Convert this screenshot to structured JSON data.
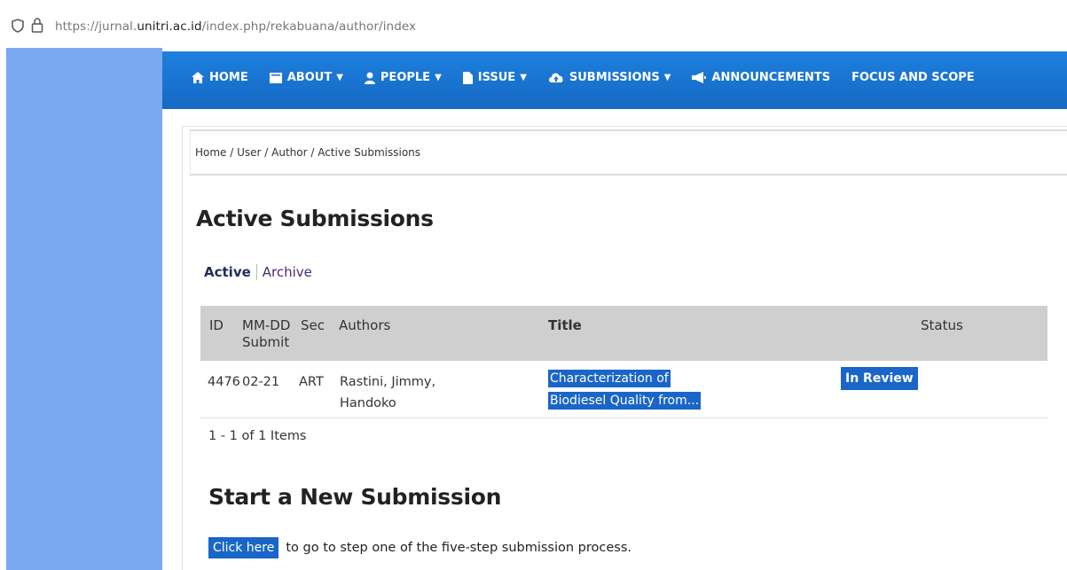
{
  "browser": {
    "url_prefix": "https://jurnal.",
    "url_domain": "unitri.ac.id",
    "url_path": "/index.php/rekabuana/author/index",
    "shield_icon": "shield-icon",
    "lock_icon": "lock-icon"
  },
  "nav": {
    "items": [
      {
        "label": "HOME",
        "icon": "home-icon",
        "dropdown": false
      },
      {
        "label": "ABOUT",
        "icon": "book-icon",
        "dropdown": true
      },
      {
        "label": "PEOPLE",
        "icon": "user-icon",
        "dropdown": true
      },
      {
        "label": "ISSUE",
        "icon": "file-icon",
        "dropdown": true
      },
      {
        "label": "SUBMISSIONS",
        "icon": "upload-cloud-icon",
        "dropdown": true
      },
      {
        "label": "ANNOUNCEMENTS",
        "icon": "megaphone-icon",
        "dropdown": false
      },
      {
        "label": "FOCUS AND SCOPE",
        "icon": "",
        "dropdown": false
      }
    ],
    "caret": "▼"
  },
  "breadcrumb": "Home / User / Author / Active Submissions",
  "page_title": "Active Submissions",
  "tabs": {
    "active": "Active",
    "archive": "Archive"
  },
  "table": {
    "headers": {
      "id": "ID",
      "date_line1": "MM-DD",
      "date_line2": "Submit",
      "sec": "Sec",
      "authors": "Authors",
      "title": "Title",
      "status": "Status"
    },
    "rows": [
      {
        "id": "4476",
        "date": "02-21",
        "sec": "ART",
        "authors_line1": "Rastini, Jimmy,",
        "authors_line2": "Handoko",
        "title": "Characterization of Biodiesel Quality from...",
        "status": "In Review"
      }
    ]
  },
  "pager": "1 - 1 of 1 Items",
  "new_submission": {
    "title": "Start a New Submission",
    "link_label": "Click here",
    "text": "to go to step one of the five-step submission process."
  },
  "colors": {
    "nav_blue": "#1a6fd0",
    "left_panel": "#7aa9f2",
    "link_bg": "#1a66c8",
    "table_header": "#cfcfcf"
  }
}
